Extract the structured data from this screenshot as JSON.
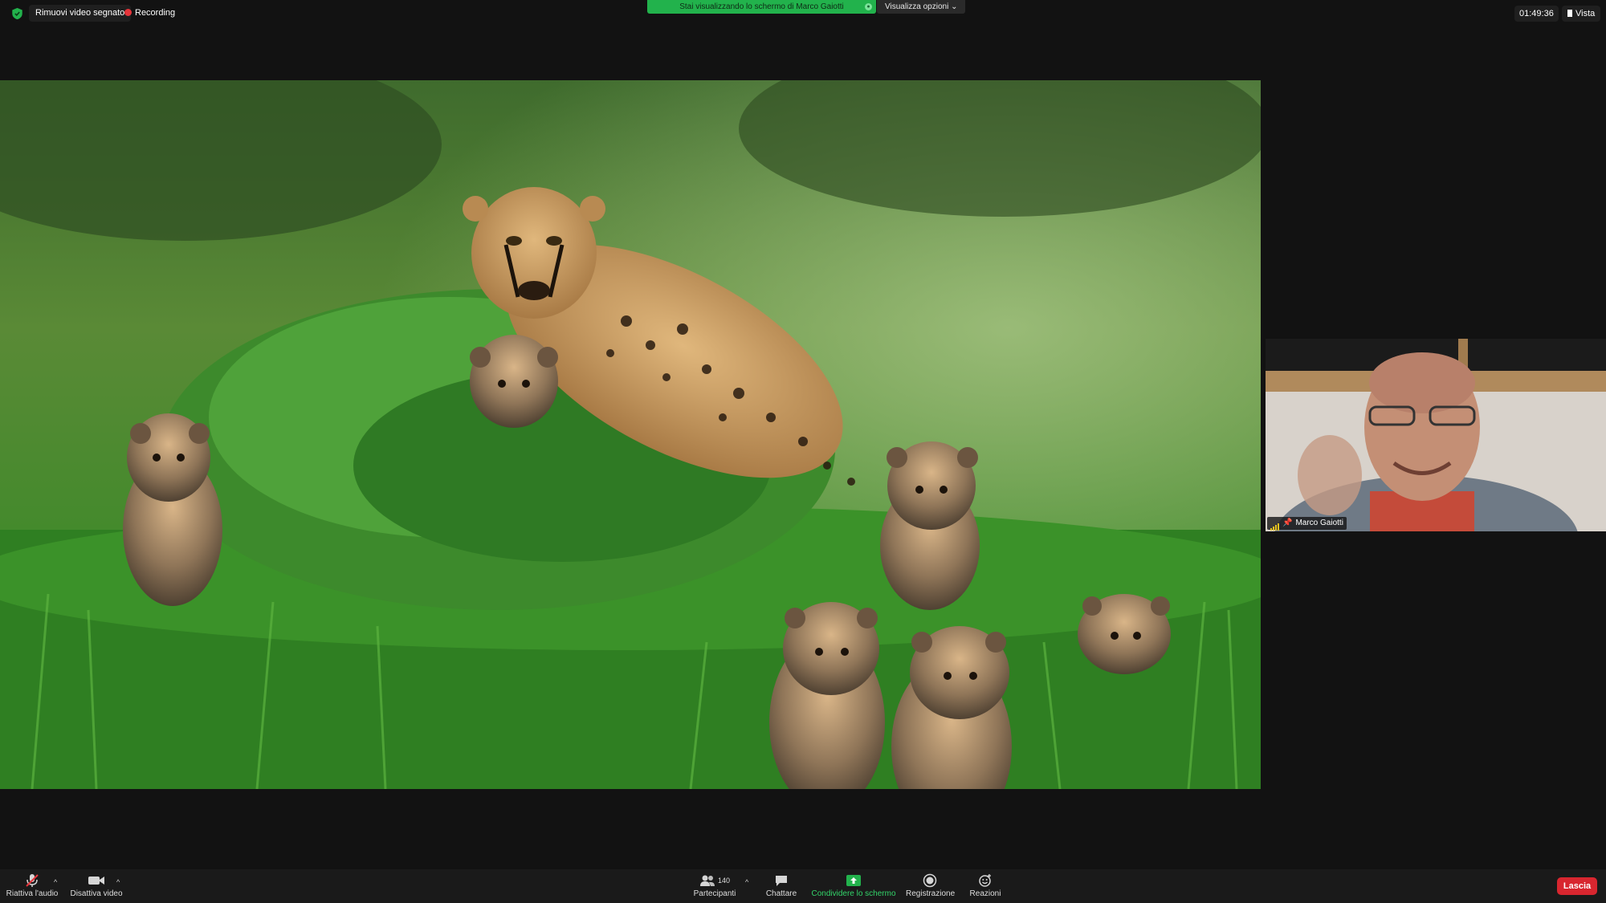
{
  "topbar": {
    "remove_video_label": "Rimuovi video segnato",
    "recording_label": "Recording",
    "share_banner_text": "Stai visualizzando lo schermo di Marco Gaiotti",
    "view_options_label": "Visualizza opzioni ⌄",
    "time": "01:49:36",
    "view_label": "Vista"
  },
  "participant": {
    "name": "Marco Gaiotti"
  },
  "toolbar": {
    "unmute_label": "Riattiva l'audio",
    "stop_video_label": "Disattiva video",
    "participants_label": "Partecipanti",
    "participants_count": "140",
    "chat_label": "Chattare",
    "share_label": "Condividere lo schermo",
    "record_label": "Registrazione",
    "reactions_label": "Reazioni",
    "leave_label": "Lascia"
  },
  "colors": {
    "share_green": "#22b24c",
    "leave_red": "#d8262f",
    "record_red": "#e5343a"
  },
  "icons": [
    "shield-icon",
    "record-dot-icon",
    "grid-icon",
    "mic-muted-icon",
    "video-camera-icon",
    "participants-icon",
    "chat-icon",
    "share-screen-icon",
    "record-icon",
    "reactions-icon",
    "chevron-up-icon",
    "signal-bars-icon",
    "pin-icon"
  ]
}
